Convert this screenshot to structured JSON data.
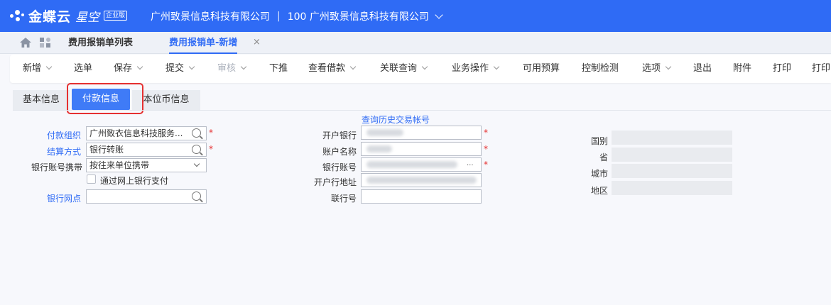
{
  "header": {
    "brand": "金蝶云",
    "product": "星空",
    "edition_badge": "企业版",
    "company": "广州致景信息科技有限公司",
    "org": "100 广州致景信息科技有限公司"
  },
  "tabs": {
    "list": "费用报销单列表",
    "current": "费用报销单-新增",
    "close": "×"
  },
  "toolbar": [
    "新增",
    "选单",
    "保存",
    "提交",
    "审核",
    "下推",
    "查看借款",
    "关联查询",
    "业务操作",
    "可用预算",
    "控制检测",
    "选项",
    "退出",
    "附件",
    "打印",
    "打印"
  ],
  "subtabs": {
    "basic": "基本信息",
    "payment": "付款信息",
    "base_currency": "本位币信息"
  },
  "form": {
    "left": {
      "pay_org_label": "付款组织",
      "pay_org_value": "广州致衣信息科技服务...",
      "settle_label": "结算方式",
      "settle_value": "银行转账",
      "account_carry_label": "银行账号携带",
      "account_carry_value": "按往来单位携带",
      "online_pay_label": "通过网上银行支付",
      "branch_label": "银行网点",
      "branch_value": ""
    },
    "middle": {
      "history_link": "查询历史交易帐号",
      "bank_label": "开户银行",
      "account_name_label": "账户名称",
      "account_no_label": "银行账号",
      "account_no_more": "...",
      "bank_address_label": "开户行地址",
      "union_no_label": "联行号"
    },
    "right": {
      "country_label": "国别",
      "province_label": "省",
      "city_label": "城市",
      "district_label": "地区"
    },
    "required_mark": "*"
  },
  "colors": {
    "header_bg": "#2f6bf5",
    "active_tab": "#3f7bf7",
    "highlight": "#e53030"
  }
}
